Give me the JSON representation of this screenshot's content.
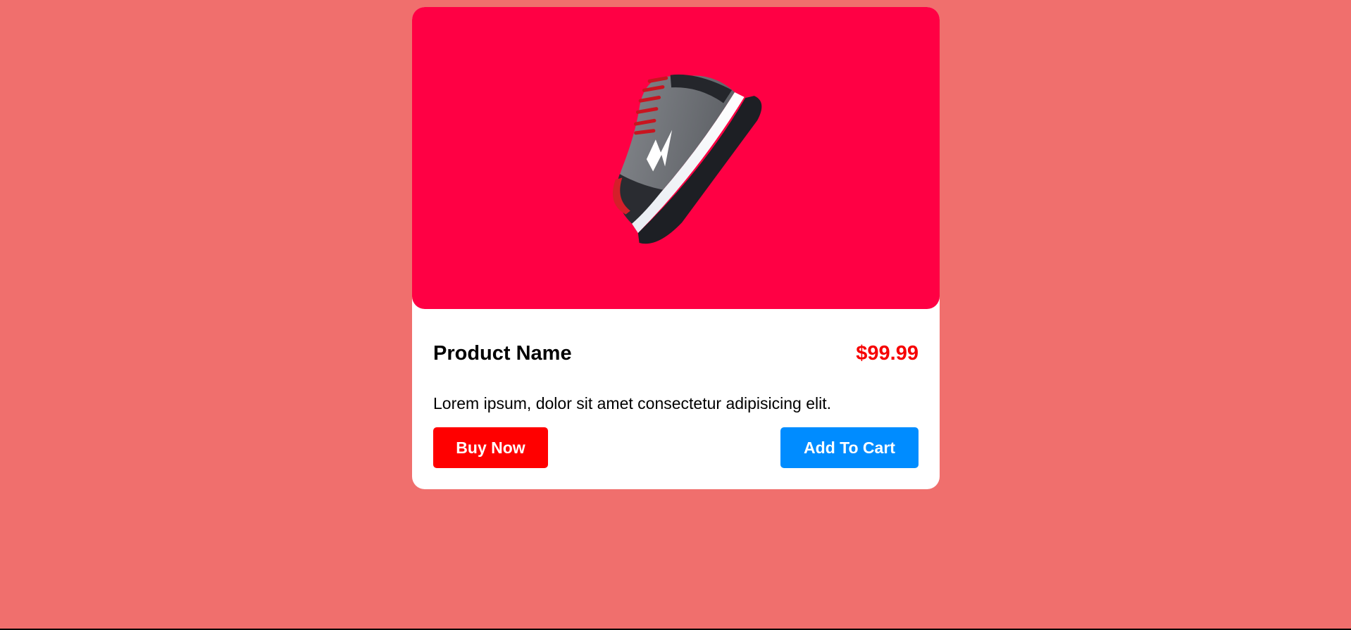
{
  "colors": {
    "page_background": "#f06f6d",
    "image_background": "#ff0044",
    "card_background": "#ffffff",
    "price": "#f60000",
    "buy_button": "#ff0000",
    "cart_button": "#008cff"
  },
  "product": {
    "image_icon": "sneaker-image",
    "name": "Product Name",
    "price": "$99.99",
    "description": "Lorem ipsum, dolor sit amet consectetur adipisicing elit."
  },
  "actions": {
    "buy_label": "Buy Now",
    "cart_label": "Add To Cart"
  }
}
